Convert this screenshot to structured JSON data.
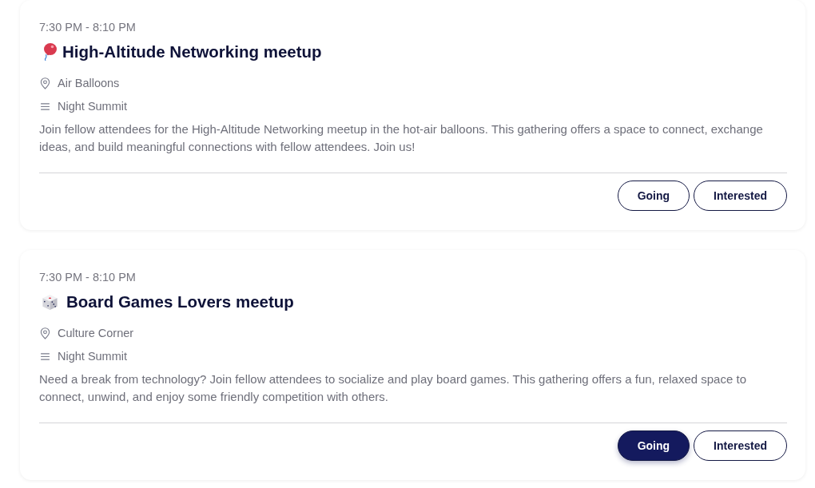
{
  "events": [
    {
      "kind": "balloon",
      "time": "7:30 PM - 8:10 PM",
      "title": "High-Altitude Networking meetup",
      "location": "Air Balloons",
      "track": "Night Summit",
      "description": "Join fellow attendees for the High-Altitude Networking meetup in the hot-air balloons. This gathering offers a space to connect, exchange ideas, and build meaningful connections with fellow attendees. Join us!",
      "buttons": [
        {
          "label": "Going",
          "selected": false
        },
        {
          "label": "Interested",
          "selected": false
        }
      ]
    },
    {
      "kind": "dice",
      "time": "7:30 PM - 8:10 PM",
      "title": "Board Games Lovers meetup",
      "location": "Culture Corner",
      "track": "Night Summit",
      "description": "Need a break from technology? Join fellow attendees to socialize and play board games. This gathering offers a fun, relaxed space to connect, unwind, and enjoy some friendly competition with others.",
      "buttons": [
        {
          "label": "Going",
          "selected": true
        },
        {
          "label": "Interested",
          "selected": false
        }
      ]
    }
  ]
}
